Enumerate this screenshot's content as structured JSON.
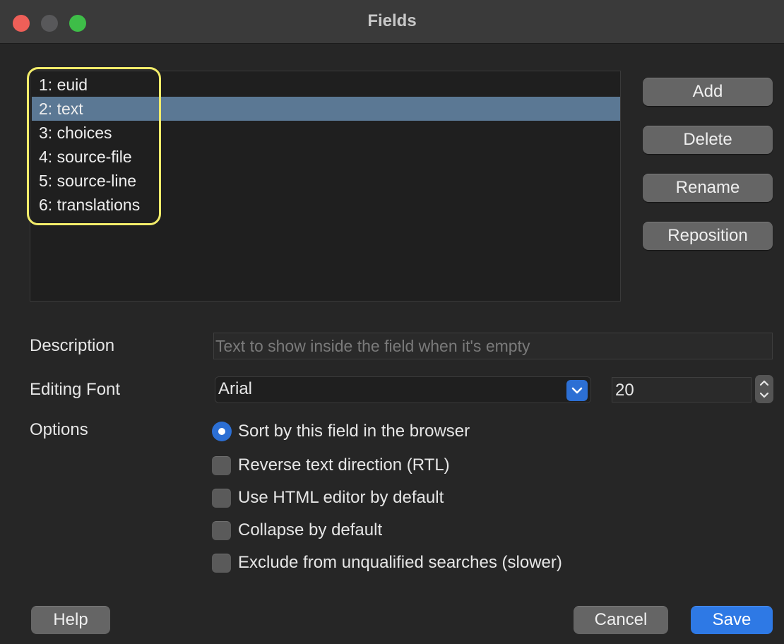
{
  "window": {
    "title": "Fields"
  },
  "fields": {
    "items": [
      {
        "label": "1: euid"
      },
      {
        "label": "2: text"
      },
      {
        "label": "3: choices"
      },
      {
        "label": "4: source-file"
      },
      {
        "label": "5: source-line"
      },
      {
        "label": "6: translations"
      }
    ],
    "selected_index": 1
  },
  "side_buttons": {
    "add": "Add",
    "delete": "Delete",
    "rename": "Rename",
    "reposition": "Reposition"
  },
  "description": {
    "label": "Description",
    "placeholder": "Text to show inside the field when it's empty",
    "value": ""
  },
  "editing_font": {
    "label": "Editing Font",
    "font": "Arial",
    "size": "20"
  },
  "options": {
    "label": "Options",
    "sort": {
      "label": "Sort by this field in the browser",
      "checked": true
    },
    "rtl": {
      "label": "Reverse text direction (RTL)",
      "checked": false
    },
    "html_editor": {
      "label": "Use HTML editor by default",
      "checked": false
    },
    "collapse": {
      "label": "Collapse by default",
      "checked": false
    },
    "exclude": {
      "label": "Exclude from unqualified searches (slower)",
      "checked": false
    }
  },
  "footer": {
    "help": "Help",
    "cancel": "Cancel",
    "save": "Save"
  },
  "colors": {
    "accent": "#2e79e5",
    "selection": "#5b7894",
    "highlight_ring": "#f2ec6a"
  }
}
